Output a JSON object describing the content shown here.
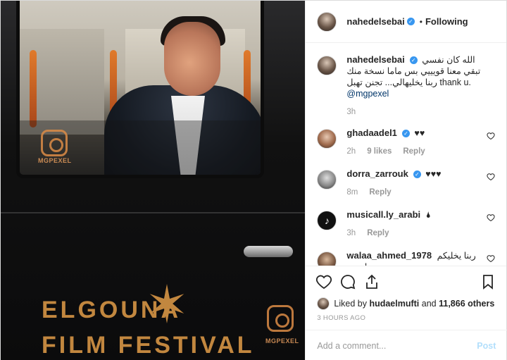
{
  "post": {
    "username": "nahedelsebai",
    "following_label": "Following",
    "dot": "•"
  },
  "photo": {
    "watermark_text": "MGPEXEL",
    "festival_line1": "ELGOUNA",
    "festival_line2": "FILM FESTIVAL"
  },
  "caption": {
    "username": "nahedelsebai",
    "text_ar": "الله كان نفسي تبقي معنا قويييي بس ماما نسخة منك ربنا يخليهالي... تجنن تهبل",
    "text_en": "thank u.",
    "mention": "@mgpexel",
    "time": "3h"
  },
  "comments": [
    {
      "username": "ghadaadel1",
      "verified": true,
      "text": "♥♥",
      "time": "2h",
      "likes": "9 likes",
      "reply": "Reply"
    },
    {
      "username": "dorra_zarrouk",
      "verified": true,
      "text": "♥♥♥",
      "time": "8m",
      "likes": "",
      "reply": "Reply"
    },
    {
      "username": "musicall.ly_arabi",
      "verified": false,
      "text": "🌢",
      "time": "3h",
      "likes": "",
      "reply": "Reply"
    },
    {
      "username": "walaa_ahmed_1978",
      "verified": false,
      "text": "ربنا يخليكم لبعض",
      "time": "",
      "likes": "",
      "reply": ""
    }
  ],
  "liked_by": {
    "prefix": "Liked by",
    "user": "hudaelmufti",
    "and": "and",
    "others": "11,866 others"
  },
  "time_ago": "3 HOURS AGO",
  "add_comment": {
    "placeholder": "Add a comment...",
    "post_label": "Post"
  },
  "colors": {
    "verified": "#3897f0",
    "link": "#003569",
    "post_disabled": "#b2dffc",
    "festival_gold": "#c2873f"
  }
}
